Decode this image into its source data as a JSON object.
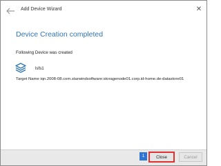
{
  "window": {
    "title": "Add Device Wizard",
    "close_glyph": "✕"
  },
  "content": {
    "heading": "Device Creation completed",
    "subtext": "Following Device was created",
    "device_name": "lsfs1",
    "target_line": "Target Name iqn.2008-08.com.starwindsoftware:storagenode01.corp.id-home.de-datastore01"
  },
  "footer": {
    "step_badge": "1",
    "close_label": "Close",
    "cancel_label": "Cancel"
  },
  "colors": {
    "accent": "#2e74b5",
    "highlight": "#e03030",
    "badge": "#2e74d5"
  },
  "icons": {
    "back": "arrow-left-icon",
    "device": "stacked-layers-icon",
    "close": "close-icon"
  }
}
